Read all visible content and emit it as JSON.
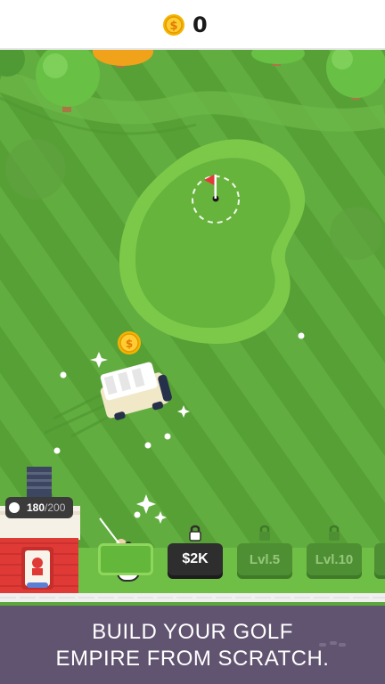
{
  "hud": {
    "coin_icon": "dollar-coin-icon",
    "coin_count": "0"
  },
  "tee_counter": {
    "current": "180",
    "max": "/200"
  },
  "upgrade_slots": [
    {
      "label": "",
      "state": "active-golfer"
    },
    {
      "label": "$2K",
      "state": "buy"
    },
    {
      "label": "Lvl.5",
      "state": "locked"
    },
    {
      "label": "Lvl.10",
      "state": "locked"
    }
  ],
  "banner": {
    "line1": "BUILD YOUR GOLF",
    "line2": "EMPIRE FROM SCRATCH."
  },
  "colors": {
    "grass_light": "#62ad40",
    "grass_dark": "#57a036",
    "green": "#7cc94a",
    "fairway_path": "#6cb646",
    "building_red": "#e03a37",
    "banner": "#615470",
    "coin": "#f5b400"
  }
}
